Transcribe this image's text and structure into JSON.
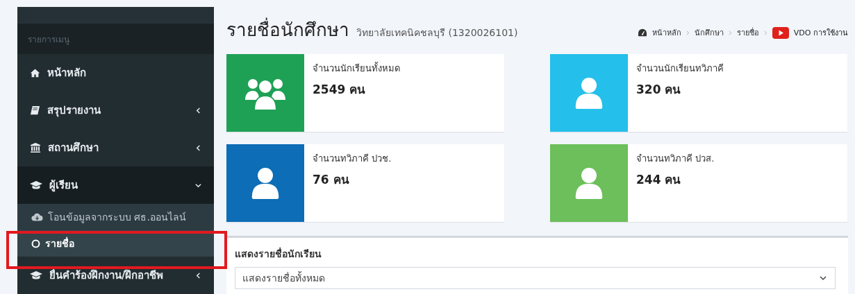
{
  "sidebar": {
    "header": "รายการเมนู",
    "items": [
      {
        "label": "หน้าหลัก",
        "has_submenu": false,
        "expanded": false,
        "selected": false
      },
      {
        "label": "สรุปรายงาน",
        "has_submenu": true,
        "expanded": false,
        "selected": false
      },
      {
        "label": "สถานศึกษา",
        "has_submenu": true,
        "expanded": false,
        "selected": false
      },
      {
        "label": "ผู้เรียน",
        "has_submenu": true,
        "expanded": true,
        "selected": false,
        "children": [
          {
            "label": "โอนข้อมูลจากระบบ ศธ.ออนไลน์",
            "selected": false
          },
          {
            "label": "รายชื่อ",
            "selected": true
          }
        ]
      },
      {
        "label": "ยื่นคำร้องฝึกงาน/ฝึกอาชีพ",
        "has_submenu": true,
        "expanded": false,
        "selected": false
      }
    ]
  },
  "page": {
    "title": "รายชื่อนักศึกษา",
    "subtitle": "วิทยาลัยเทคนิคชลบุรี (1320026101)"
  },
  "breadcrumb": [
    "หน้าหลัก",
    "นักศึกษา",
    "รายชื่อ"
  ],
  "video_link": "VDO การใช้งาน",
  "stats": [
    {
      "label": "จำนวนนักเรียนทั้งหมด",
      "value": "2549 คน",
      "color": "#1fa155",
      "kind": "group"
    },
    {
      "label": "จำนวนนักเรียนทวิภาคี",
      "value": "320 คน",
      "color": "#24bfea",
      "kind": "person"
    },
    {
      "label": "จำนวนทวิภาคี ปวช.",
      "value": "76 คน",
      "color": "#0d6db6",
      "kind": "person"
    },
    {
      "label": "จำนวนทวิภาคี ปวส.",
      "value": "244 คน",
      "color": "#6cbf5a",
      "kind": "person"
    }
  ],
  "list_panel": {
    "label": "แสดงรายชื่อนักเรียน",
    "select_value": "แสดงรายชื่อทั้งหมด"
  }
}
